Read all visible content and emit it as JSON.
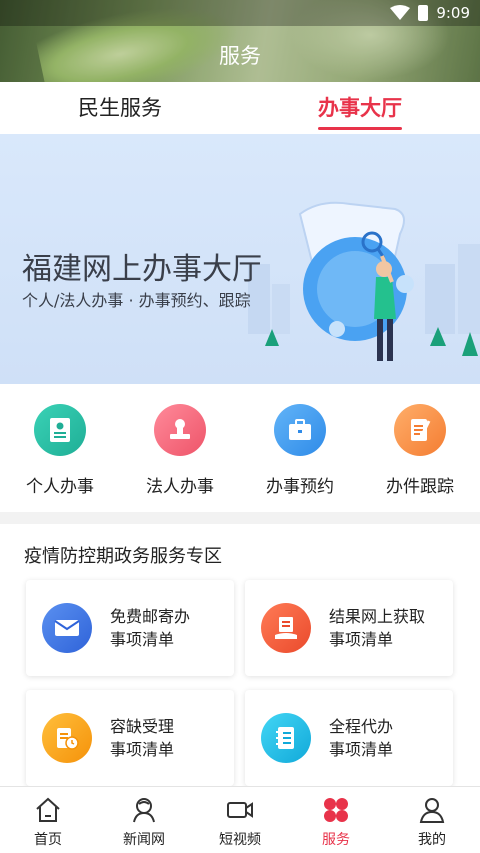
{
  "status_bar": {
    "time": "9:09"
  },
  "header": {
    "title": "服务"
  },
  "tabs": [
    {
      "label": "民生服务",
      "active": false
    },
    {
      "label": "办事大厅",
      "active": true
    }
  ],
  "banner": {
    "title": "福建网上办事大厅",
    "subtitle": "个人/法人办事 · 办事预约、跟踪"
  },
  "services": [
    {
      "label": "个人办事",
      "icon": "id-card-icon",
      "color": "#2cc2a8"
    },
    {
      "label": "法人办事",
      "icon": "stamp-icon",
      "color": "#f36a7e"
    },
    {
      "label": "办事预约",
      "icon": "briefcase-icon",
      "color": "#3f9bf0"
    },
    {
      "label": "办件跟踪",
      "icon": "document-edit-icon",
      "color": "#f8924a"
    }
  ],
  "epidemic_section": {
    "title": "疫情防控期政务服务专区",
    "cards": [
      {
        "line1": "免费邮寄办",
        "line2": "事项清单",
        "icon": "envelope-icon",
        "color": "#3a73e8"
      },
      {
        "line1": "结果网上获取",
        "line2": "事项清单",
        "icon": "hand-document-icon",
        "color": "#f2553a"
      },
      {
        "line1": "容缺受理",
        "line2": "事项清单",
        "icon": "clipboard-clock-icon",
        "color": "#f7a11f"
      },
      {
        "line1": "全程代办",
        "line2": "事项清单",
        "icon": "notebook-icon",
        "color": "#1fbfe8"
      }
    ]
  },
  "bottom_nav": [
    {
      "label": "首页",
      "icon": "home-icon",
      "active": false
    },
    {
      "label": "新闻网",
      "icon": "news-icon",
      "active": false
    },
    {
      "label": "短视频",
      "icon": "video-icon",
      "active": false
    },
    {
      "label": "服务",
      "icon": "service-grid-icon",
      "active": true
    },
    {
      "label": "我的",
      "icon": "user-icon",
      "active": false
    }
  ],
  "colors": {
    "accent": "#e8334a",
    "banner_bg": "#d9e8fb"
  }
}
